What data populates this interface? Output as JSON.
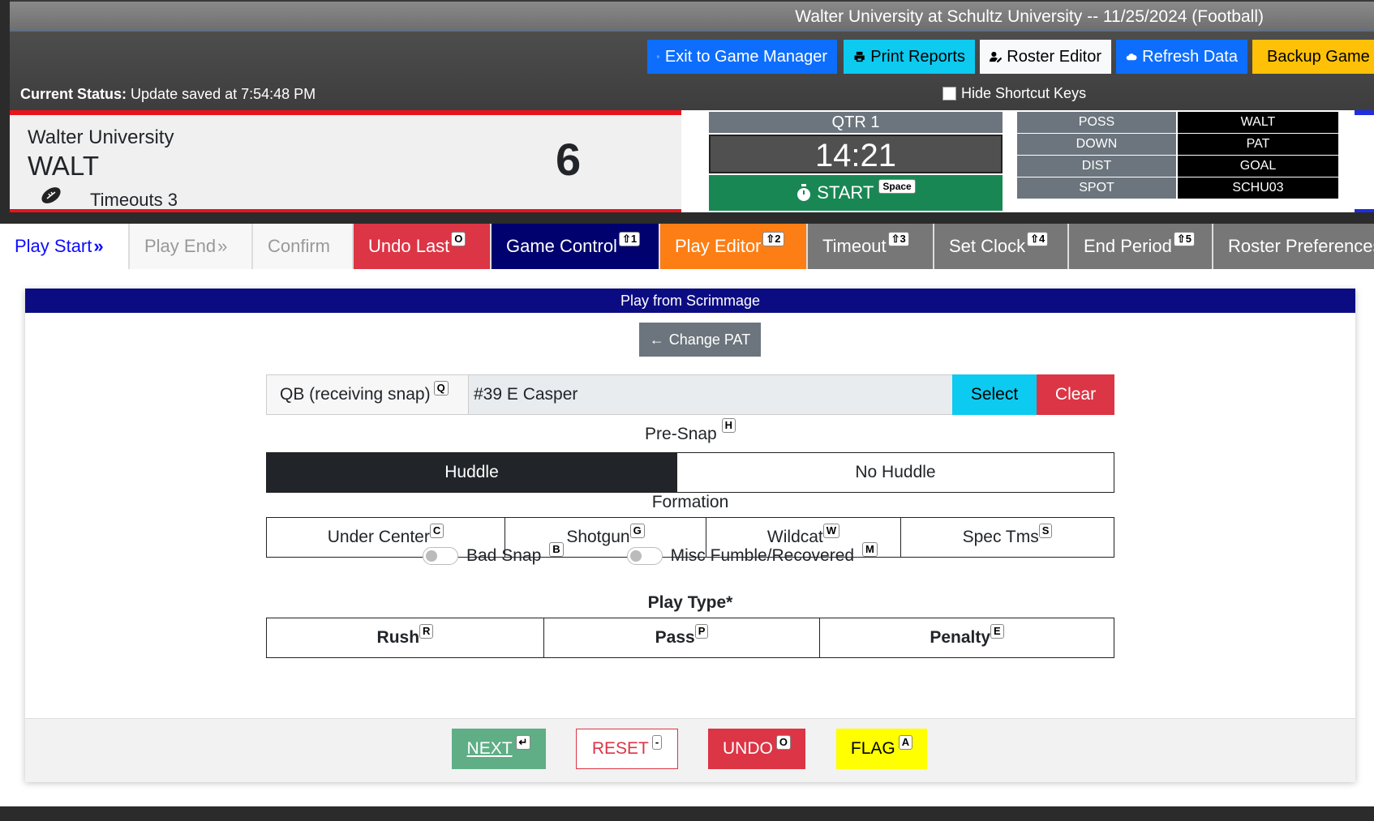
{
  "header": {
    "title": "Walter University at Schultz University -- 11/25/2024 (Football)",
    "buttons": {
      "exit": "Exit to Game Manager",
      "print": "Print Reports",
      "roster": "Roster Editor",
      "refresh": "Refresh Data",
      "backup": "Backup Game"
    },
    "status_label": "Current Status:",
    "status_text": "Update saved at 7:54:48 PM",
    "hide_keys": "Hide Shortcut Keys"
  },
  "scoreboard": {
    "team_name": "Walter University",
    "team_abbr": "WALT",
    "score": "6",
    "timeouts": "Timeouts 3",
    "qtr": "QTR 1",
    "clock": "14:21",
    "start": "START",
    "start_key": "Space",
    "situation": [
      {
        "label": "POSS",
        "value": "WALT"
      },
      {
        "label": "DOWN",
        "value": "PAT"
      },
      {
        "label": "DIST",
        "value": "GOAL"
      },
      {
        "label": "SPOT",
        "value": "SCHU03"
      }
    ]
  },
  "tabs": [
    {
      "label": "Play Start",
      "key": ""
    },
    {
      "label": "Play End",
      "key": ""
    },
    {
      "label": "Confirm",
      "key": ""
    },
    {
      "label": "Undo Last",
      "key": "O"
    },
    {
      "label": "Game Control",
      "key": "⇧1"
    },
    {
      "label": "Play Editor",
      "key": "⇧2"
    },
    {
      "label": "Timeout",
      "key": "⇧3"
    },
    {
      "label": "Set Clock",
      "key": "⇧4"
    },
    {
      "label": "End Period",
      "key": "⇧5"
    },
    {
      "label": "Roster Preferences",
      "key": ""
    }
  ],
  "play": {
    "header": "Play from Scrimmage",
    "change_pat": "Change PAT",
    "qb_label": "QB (receiving snap)",
    "qb_key": "Q",
    "qb_value": "#39 E Casper",
    "select": "Select",
    "clear": "Clear",
    "presnap_label": "Pre-Snap",
    "presnap_key": "H",
    "presnap": [
      "Huddle",
      "No Huddle"
    ],
    "formation_label": "Formation",
    "formations": [
      {
        "label": "Under Center",
        "key": "C"
      },
      {
        "label": "Shotgun",
        "key": "G"
      },
      {
        "label": "Wildcat",
        "key": "W"
      },
      {
        "label": "Spec Tms",
        "key": "S"
      }
    ],
    "bad_snap": "Bad Snap",
    "bad_snap_key": "B",
    "misc_fumble": "Misc Fumble/Recovered",
    "misc_fumble_key": "M",
    "play_type_label": "Play Type*",
    "play_types": [
      {
        "label": "Rush",
        "key": "R"
      },
      {
        "label": "Pass",
        "key": "P"
      },
      {
        "label": "Penalty",
        "key": "E"
      }
    ]
  },
  "footer": {
    "next": "NEXT",
    "next_key": "↵",
    "reset": "RESET",
    "reset_key": "-",
    "undo": "UNDO",
    "undo_key": "O",
    "flag": "FLAG",
    "flag_key": "A"
  },
  "colors": {
    "exit": "#0d6efd",
    "print": "#0dcaf0",
    "roster": "#f8f9fa",
    "refresh": "#0d6efd",
    "backup": "#ffc107",
    "home": "#e8141c",
    "away": "#1f2ee0",
    "start": "#198754",
    "undo_last": "#dc3545",
    "game_control": "#00006e",
    "play_editor": "#fd7e14",
    "grey_tab": "#6c757d",
    "card_header": "#0c0c82",
    "next": "#5fae86",
    "flag": "#ffff00"
  }
}
